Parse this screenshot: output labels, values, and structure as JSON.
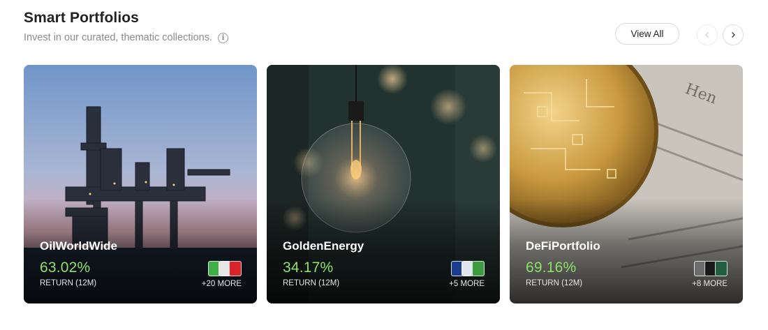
{
  "section": {
    "title": "Smart Portfolios",
    "subtitle": "Invest in our curated, thematic collections.",
    "view_all_label": "View All"
  },
  "icons": {
    "info": "info-icon",
    "prev": "chevron-left-icon",
    "next": "chevron-right-icon"
  },
  "cards": [
    {
      "name": "OilWorldWide",
      "return": "63.02%",
      "return_label": "RETURN (12M)",
      "more": "+20 MORE",
      "logo_colors": [
        "#3fae49",
        "#e6e6e6",
        "#d8232a"
      ]
    },
    {
      "name": "GoldenEnergy",
      "return": "34.17%",
      "return_label": "RETURN (12M)",
      "more": "+5 MORE",
      "logo_colors": [
        "#1b3d8f",
        "#dfe6ee",
        "#3d9a3f"
      ]
    },
    {
      "name": "DeFiPortfolio",
      "return": "69.16%",
      "return_label": "RETURN (12M)",
      "more": "+8 MORE",
      "logo_colors": [
        "#6c6c6c",
        "#1a1a1a",
        "#1f5f3f"
      ]
    }
  ],
  "colors": {
    "return_green": "#8ee06a",
    "title": "#222222",
    "subtitle": "#8a8a8a"
  }
}
